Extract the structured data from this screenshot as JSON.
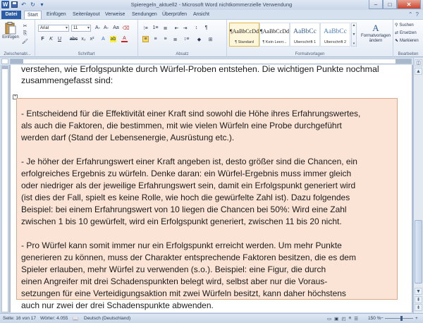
{
  "window": {
    "title": "Spieregeln_aktuell2 - Microsoft Word nichtkommerzielle Verwendung"
  },
  "tabs": [
    "Datei",
    "Start",
    "Einfügen",
    "Seitenlayout",
    "Verweise",
    "Sendungen",
    "Überprüfen",
    "Ansicht"
  ],
  "ribbon": {
    "clipboard": {
      "paste_label": "Einfügen",
      "group_label": "Zwischenabl..."
    },
    "font": {
      "font_name": "Arial",
      "font_size": "11",
      "group_label": "Schriftart"
    },
    "paragraph": {
      "group_label": "Absatz"
    },
    "styles": {
      "items": [
        {
          "sample": "¶AaBbCcDd",
          "name": "¶ Standard"
        },
        {
          "sample": "¶AaBbCcDd",
          "name": "¶ Kein Leerr..."
        },
        {
          "sample": "AaBbCc",
          "name": "Überschrift 1"
        },
        {
          "sample": "AaBbCc",
          "name": "Überschrift 2"
        }
      ],
      "change_label": "Formatvorlagen ändern",
      "group_label": "Formatvorlagen"
    },
    "editing": {
      "find_label": "Suchen",
      "replace_label": "Ersetzen",
      "select_label": "Markieren",
      "group_label": "Bearbeiten"
    }
  },
  "document": {
    "intro_lines": [
      "verstehen, wie Erfolgspunkte durch Würfel-Proben entstehen. Die wichtigen Punkte nochmal",
      "zusammengefasst sind:"
    ],
    "box_lines": [
      "- Entscheidend für die Effektivität einer Kraft sind sowohl die Höhe ihres Erfahrungswertes,",
      "  als auch die Faktoren, die bestimmen, mit wie vielen Würfeln eine Probe durchgeführt",
      "  werden darf  (Stand der Lebensenergie, Ausrüstung etc.).",
      "",
      "- Je höher der Erfahrungswert einer Kraft angeben ist, desto größer sind die Chancen, ein",
      "  erfolgreiches Ergebnis zu würfeln. Denke daran: ein Würfel-Ergebnis muss immer gleich",
      "  oder niedriger als der jeweilige Erfahrungswert sein, damit ein Erfolgspunkt generiert wird",
      "  (ist dies der Fall, spielt es keine Rolle, wie hoch die gewürfelte Zahl ist). Dazu folgendes",
      "  Beispiel: bei einem Erfahrungswert von 10 liegen die Chancen bei 50%:  Wird eine Zahl",
      "  zwischen 1 bis 10 gewürfelt, wird ein Erfolgspunkt generiert, zwischen 11 bis 20 nicht.",
      "",
      "- Pro Würfel kann somit immer nur ein Erfolgspunkt erreicht werden. Um mehr Punkte",
      "  generieren zu können, muss der Charakter entsprechende Faktoren besitzen, die es dem",
      "  Spieler erlauben, mehr Würfel zu verwenden (s.o.). Beispiel: eine Figur, die durch",
      "  einen Angreifer mit drei Schadenspunkten belegt wird, selbst  aber nur die Voraus-",
      "  setzungen  für eine Verteidigungsaktion mit zwei Würfeln besitzt, kann daher höchstens",
      "  auch nur zwei der drei Schadenspunkte abwenden."
    ]
  },
  "statusbar": {
    "page": "Seite: 16 von 17",
    "words": "Wörter: 4.055",
    "language": "Deutsch (Deutschland)",
    "zoom": "150 %"
  },
  "colors": {
    "box_fill": "#fbe4d5",
    "file_tab": "#2b5ca8"
  }
}
